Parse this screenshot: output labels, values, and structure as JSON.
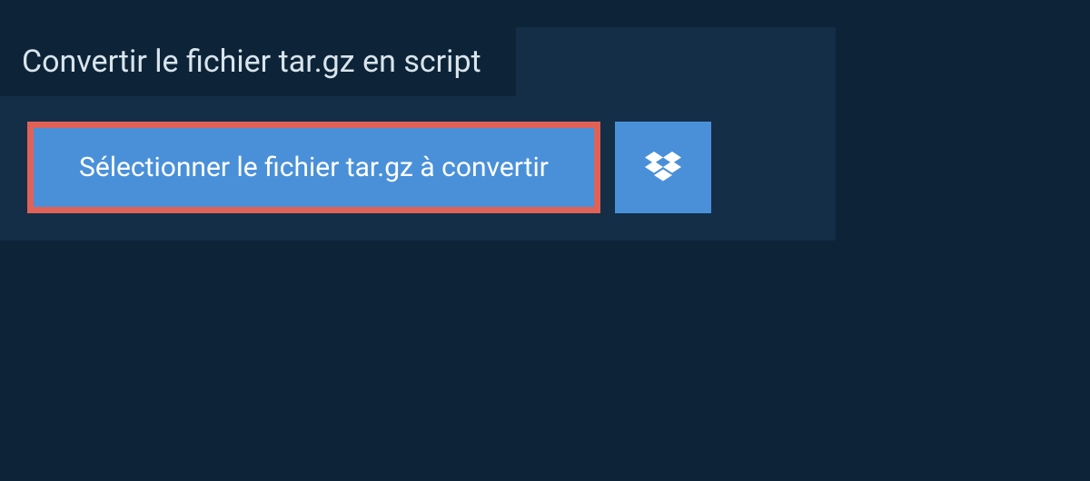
{
  "header": {
    "title": "Convertir le fichier tar.gz en script"
  },
  "actions": {
    "select_label": "Sélectionner le fichier tar.gz à convertir",
    "dropbox_icon": "dropbox"
  },
  "colors": {
    "highlight_border": "#e06257",
    "button_bg": "#4a90d9",
    "panel_bg": "#132e46",
    "page_bg": "#0d2438"
  }
}
